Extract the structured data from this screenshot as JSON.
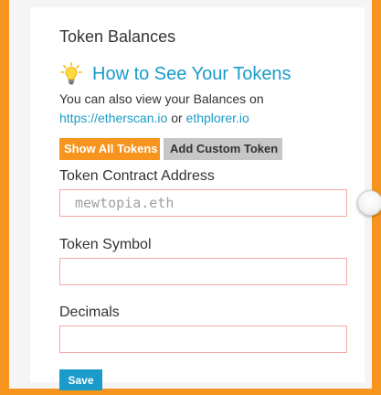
{
  "panel": {
    "heading": "Token Balances",
    "info": {
      "icon": "lightbulb-icon",
      "title": "How to See Your Tokens",
      "description_prefix": "You can also view your Balances on",
      "link1": "https://etherscan.io",
      "link_separator": "or",
      "link2": "ethplorer.io"
    },
    "tabs": [
      {
        "label": "Show All Tokens",
        "active": true
      },
      {
        "label": "Add Custom Token",
        "active": false
      }
    ],
    "form": {
      "contract_label": "Token Contract Address",
      "contract_placeholder": "mewtopia.eth",
      "contract_value": "",
      "symbol_label": "Token Symbol",
      "symbol_value": "",
      "decimals_label": "Decimals",
      "decimals_value": "",
      "save_label": "Save"
    }
  },
  "colors": {
    "accent_orange": "#f7941d",
    "link_blue": "#1a9bc9",
    "input_border": "#f4a9a2",
    "tab_inactive": "#c7c7c7"
  }
}
